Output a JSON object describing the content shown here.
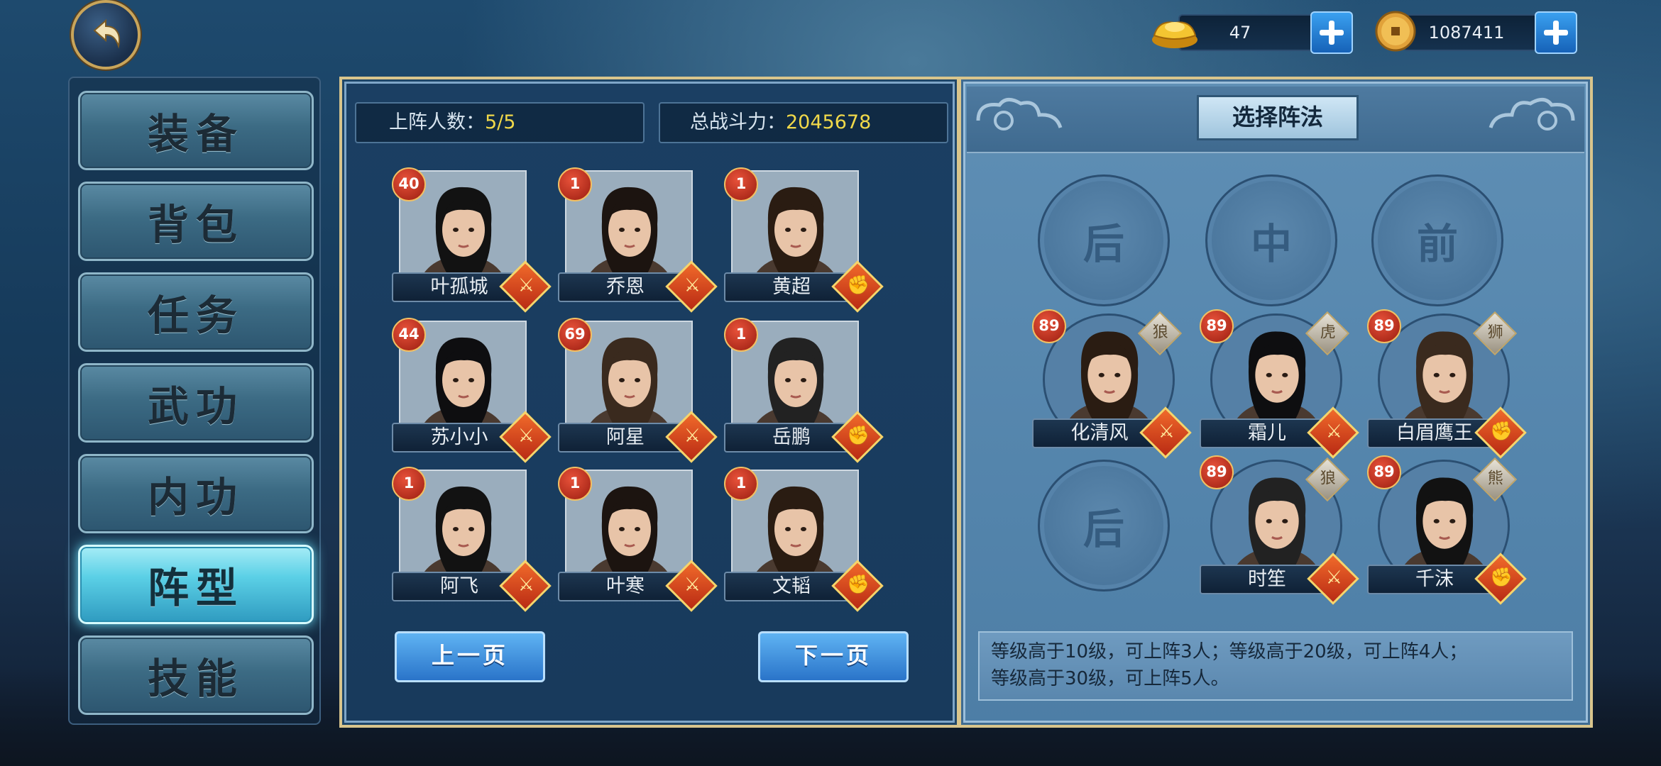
{
  "currency": {
    "gold": {
      "icon": "gold-ingot-icon",
      "value": "47"
    },
    "coins": {
      "icon": "coin-icon",
      "value": "1087411"
    }
  },
  "menu": [
    {
      "label": "装备",
      "active": false
    },
    {
      "label": "背包",
      "active": false
    },
    {
      "label": "任务",
      "active": false
    },
    {
      "label": "武功",
      "active": false
    },
    {
      "label": "内功",
      "active": false
    },
    {
      "label": "阵型",
      "active": true
    },
    {
      "label": "技能",
      "active": false
    }
  ],
  "roster": {
    "count_label": "上阵人数：",
    "count_value": "5/5",
    "power_label": "总战斗力：",
    "power_value": "2045678",
    "heroes": [
      {
        "name": "叶孤城",
        "level": "40",
        "role": "sword"
      },
      {
        "name": "乔恩",
        "level": "1",
        "role": "sword"
      },
      {
        "name": "黄超",
        "level": "1",
        "role": "fist"
      },
      {
        "name": "苏小小",
        "level": "44",
        "role": "sword"
      },
      {
        "name": "阿星",
        "level": "69",
        "role": "sword"
      },
      {
        "name": "岳鹏",
        "level": "1",
        "role": "fist"
      },
      {
        "name": "阿飞",
        "level": "1",
        "role": "sword"
      },
      {
        "name": "叶寒",
        "level": "1",
        "role": "sword"
      },
      {
        "name": "文韬",
        "level": "1",
        "role": "fist"
      }
    ],
    "prev_page": "上一页",
    "next_page": "下一页"
  },
  "formation": {
    "title": "选择阵法",
    "slots": {
      "back": "后",
      "middle": "中",
      "front": "前",
      "back2": "后"
    },
    "heroes": [
      {
        "name": "化清风",
        "level": "89",
        "role": "sword",
        "element": "wolf-icon"
      },
      {
        "name": "霜儿",
        "level": "89",
        "role": "sword",
        "element": "tiger-icon"
      },
      {
        "name": "白眉鹰王",
        "level": "89",
        "role": "fist",
        "element": "lion-icon"
      },
      {
        "name": "时笙",
        "level": "89",
        "role": "sword",
        "element": "wolf-icon"
      },
      {
        "name": "千沫",
        "level": "89",
        "role": "fist",
        "element": "bear-icon"
      }
    ],
    "info_line1": "等级高于10级，可上阵3人；等级高于20级，可上阵4人；",
    "info_line2": "等级高于30级，可上阵5人。"
  }
}
